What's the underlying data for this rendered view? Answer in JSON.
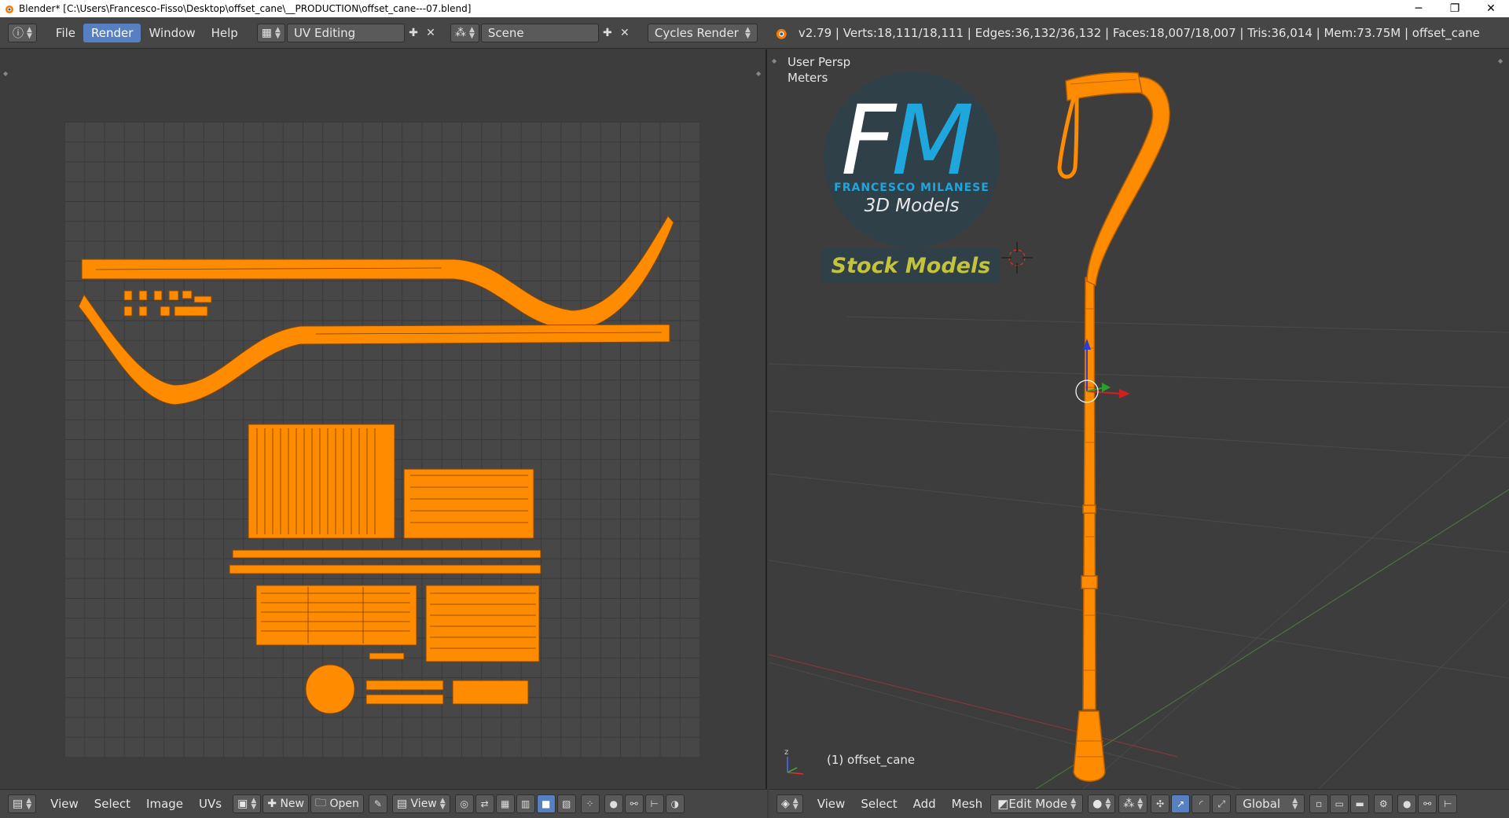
{
  "window": {
    "title": "Blender* [C:\\Users\\Francesco-Fisso\\Desktop\\offset_cane\\__PRODUCTION\\offset_cane---07.blend]",
    "minimize": "─",
    "restore": "❐",
    "close": "✕"
  },
  "info_header": {
    "menus": [
      "File",
      "Render",
      "Window",
      "Help"
    ],
    "active_menu": "Render",
    "layout": "UV Editing",
    "scene": "Scene",
    "engine": "Cycles Render",
    "stats": "v2.79 | Verts:18,111/18,111 | Edges:36,132/36,132 | Faces:18,007/18,007 | Tris:36,014 | Mem:73.75M | offset_cane"
  },
  "viewport": {
    "view_name": "User Persp",
    "units": "Meters",
    "object_label": "(1) offset_cane"
  },
  "logo": {
    "initial_f": "F",
    "initial_m": "M",
    "name": "FRANCESCO MILANESE",
    "subtitle": "3D Models",
    "tag": "Stock Models"
  },
  "uv_header": {
    "view": "View",
    "select": "Select",
    "image": "Image",
    "uvs": "UVs",
    "new": "New",
    "open": "Open",
    "view2": "View"
  },
  "v3d_header": {
    "view": "View",
    "select": "Select",
    "add": "Add",
    "mesh": "Mesh",
    "mode": "Edit Mode",
    "orientation": "Global"
  },
  "colors": {
    "mesh": "#ff8c00",
    "accent": "#5680c2",
    "logo_blue": "#1fa6dd",
    "logo_bg": "#2f4049",
    "stock_text": "#c4c43a"
  }
}
